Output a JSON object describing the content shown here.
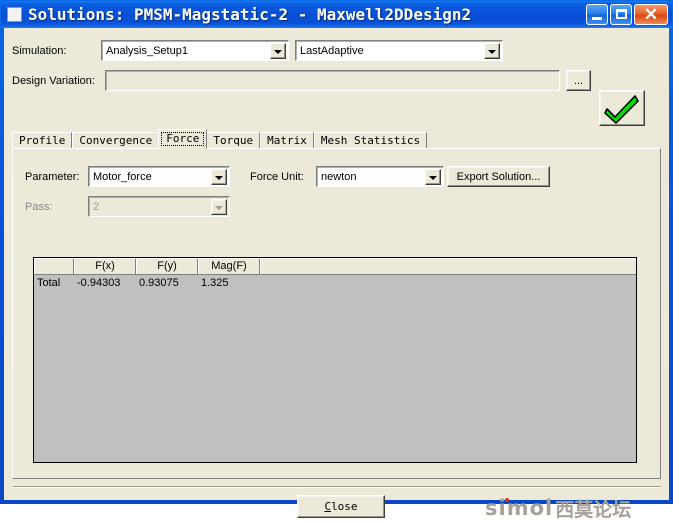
{
  "window": {
    "title": "Solutions: PMSM-Magstatic-2 - Maxwell2DDesign2",
    "icon": "window-square-icon",
    "controls": {
      "minimize": "minimize-icon",
      "maximize": "maximize-icon",
      "close": "✕"
    },
    "title_bar_color": "#0a52d6",
    "client_color": "#ece9d8"
  },
  "top": {
    "simulation_label": "Simulation:",
    "simulation_setup_value": "Analysis_Setup1",
    "simulation_solution_value": "LastAdaptive",
    "design_variation_label": "Design Variation:",
    "design_variation_value": "",
    "browse_label": "...",
    "apply_icon": "green-check-icon",
    "apply_color": "#00e000"
  },
  "tabs": [
    {
      "label": "Profile",
      "active": false
    },
    {
      "label": "Convergence",
      "active": false
    },
    {
      "label": "Force",
      "active": true
    },
    {
      "label": "Torque",
      "active": false
    },
    {
      "label": "Matrix",
      "active": false
    },
    {
      "label": "Mesh Statistics",
      "active": false
    }
  ],
  "force_panel": {
    "parameter_label": "Parameter:",
    "parameter_value": "Motor_force",
    "force_unit_label": "Force Unit:",
    "force_unit_value": "newton",
    "export_label": "Export Solution...",
    "pass_label": "Pass:",
    "pass_value": "2",
    "pass_disabled": true
  },
  "table": {
    "headers": [
      "",
      "F(x)",
      "F(y)",
      "Mag(F)",
      ""
    ],
    "rows": [
      {
        "name": "Total",
        "fx": "-0.94303",
        "fy": "0.93075",
        "mag": "1.325",
        "extra": ""
      }
    ],
    "body_color": "#c0c0c0"
  },
  "footer": {
    "close_prefix": "C",
    "close_rest": "lose",
    "watermark_text": "simol",
    "watermark_cn": "西莫论坛"
  }
}
